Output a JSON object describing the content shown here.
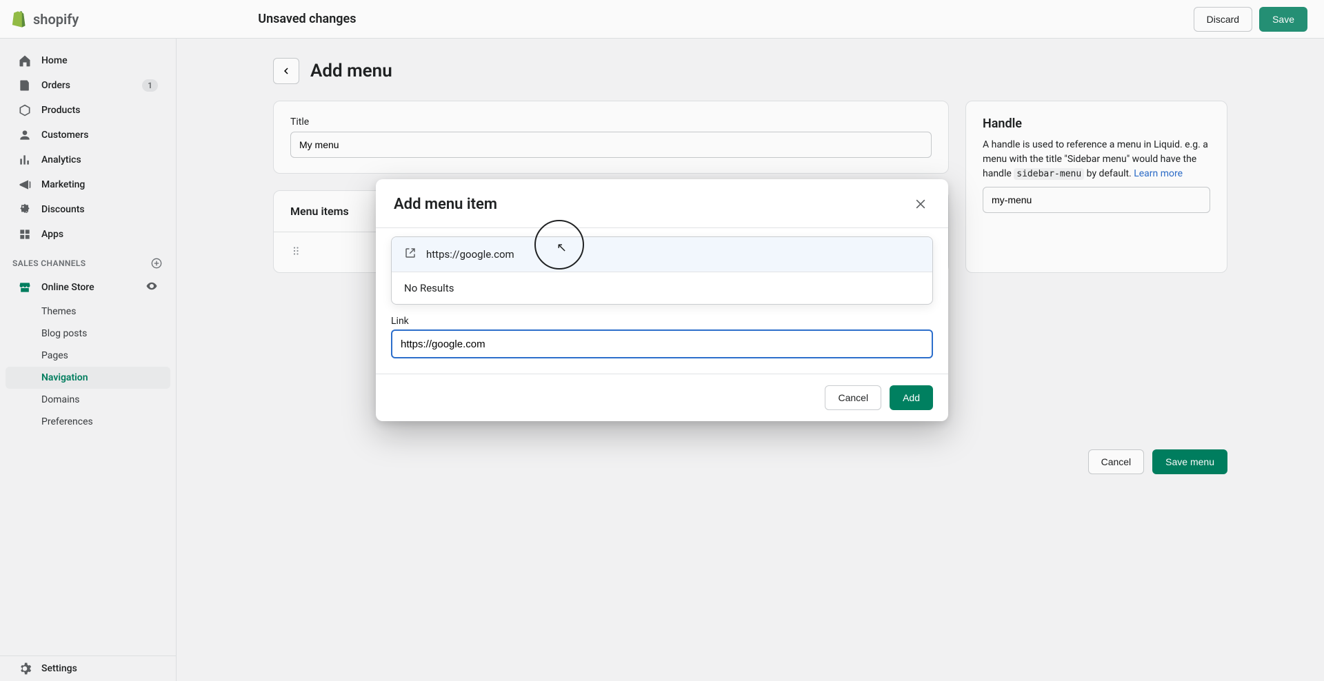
{
  "topbar": {
    "status": "Unsaved changes",
    "discard": "Discard",
    "save": "Save"
  },
  "sidebar": {
    "items": [
      {
        "icon": "home",
        "label": "Home"
      },
      {
        "icon": "orders",
        "label": "Orders",
        "badge": "1"
      },
      {
        "icon": "products",
        "label": "Products"
      },
      {
        "icon": "customers",
        "label": "Customers"
      },
      {
        "icon": "analytics",
        "label": "Analytics"
      },
      {
        "icon": "marketing",
        "label": "Marketing"
      },
      {
        "icon": "discounts",
        "label": "Discounts"
      },
      {
        "icon": "apps",
        "label": "Apps"
      }
    ],
    "channels_header": "Sales channels",
    "online_store": {
      "label": "Online Store",
      "icon": "store",
      "eye": true
    },
    "subitems": [
      {
        "label": "Themes"
      },
      {
        "label": "Blog posts"
      },
      {
        "label": "Pages"
      },
      {
        "label": "Navigation",
        "active": true
      },
      {
        "label": "Domains"
      },
      {
        "label": "Preferences"
      }
    ],
    "settings": {
      "label": "Settings"
    }
  },
  "page": {
    "title": "Add menu",
    "title_field_label": "Title",
    "title_field_value": "My menu",
    "menu_items_header": "Menu items",
    "menu_item_placeholder_row": "",
    "footer_cancel": "Cancel",
    "footer_save": "Save menu"
  },
  "handle_card": {
    "title": "Handle",
    "description_pre": "A handle is used to reference a menu in Liquid. e.g. a menu with the title \"Sidebar menu\" would have the handle ",
    "description_code": "sidebar-menu",
    "description_post": " by default. ",
    "learn_more": "Learn more",
    "value": "my-menu"
  },
  "modal": {
    "title": "Add menu item",
    "suggestion": "https://google.com",
    "no_results": "No Results",
    "link_label": "Link",
    "link_value": "https://google.com",
    "cancel": "Cancel",
    "add": "Add"
  }
}
